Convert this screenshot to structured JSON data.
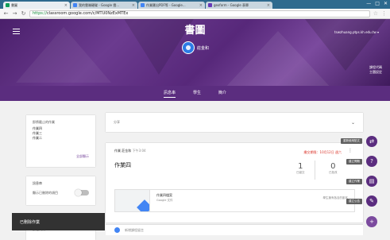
{
  "browser": {
    "tabs": [
      {
        "title": "書圖",
        "color": "#0f9d58",
        "active": true
      },
      {
        "title": "我的雲端硬碟 - Google 雲...",
        "color": "#4285f4",
        "active": false
      },
      {
        "title": "作業匯出PDF等 - Google...",
        "color": "#4285f4",
        "active": false
      },
      {
        "title": "gexform - Google 表單",
        "color": "#673ab7",
        "active": false
      }
    ],
    "url_scheme": "https://",
    "url_host": "classroom.google.com",
    "url_path": "/c/MTU0NzExMTEx",
    "win_min": "—",
    "win_max": "□",
    "win_close": "✕"
  },
  "header": {
    "class_title": "書圖",
    "teacher_name": "莊金和",
    "user_email": "tswzhuang.ptps.kh.edu.tw ▾",
    "class_code_label": "課程代碼",
    "class_code_sub": "主題設定"
  },
  "nav": {
    "tabs": [
      "訊息串",
      "學生",
      "簡介"
    ],
    "active": 0
  },
  "upcoming": {
    "title": "即將截止的作業",
    "items": [
      "作業四",
      "作業三",
      "作業二"
    ],
    "view_all": "全部顯示"
  },
  "display": {
    "title": "訊息串",
    "toggle_label": "顯示已刪除的項目"
  },
  "class_code": {
    "label": "課程代碼"
  },
  "snackbar": {
    "text": "已刪除作業"
  },
  "share_box": {
    "placeholder": "分享"
  },
  "post": {
    "meta": "作業  莊金和",
    "time": "下午3:04",
    "due": "繳交期限：10月12日 週六",
    "title": "作業四",
    "stats": [
      {
        "num": "1",
        "label": "已繳交"
      },
      {
        "num": "0",
        "label": "已批改"
      }
    ],
    "attachment_name": "作業四檔案",
    "attachment_type": "Google 文件",
    "attachment_right": "學生擁有各自的副本",
    "comment_placeholder": "新增課程留言"
  },
  "fabs": [
    {
      "icon": "⇄",
      "label": "重新使用貼文"
    },
    {
      "icon": "?",
      "label": "建立問題"
    },
    {
      "icon": "▤",
      "label": "建立作業"
    },
    {
      "icon": "✎",
      "label": "建立公告"
    },
    {
      "icon": "+",
      "label": ""
    }
  ],
  "colors": {
    "primary": "#5b2d7f",
    "due": "#d93025",
    "fab": "#5b2d7f"
  }
}
